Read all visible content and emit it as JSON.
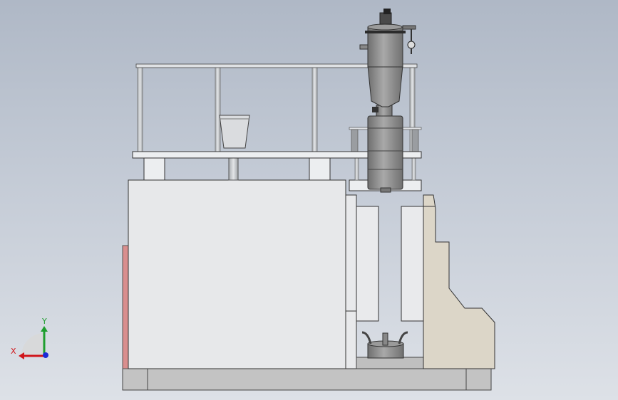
{
  "viewport": {
    "background_top": "#afb8c6",
    "background_bottom": "#dde1e7"
  },
  "triad": {
    "x_label": "X",
    "y_label": "Y",
    "x_color": "#d0161b",
    "y_color": "#1e9e2e",
    "z_color": "#1b2bd6"
  },
  "materials": {
    "frame_panel": "#e7e8ea",
    "steel_gray": "#8e8e8e",
    "base_gray": "#c3c3c3",
    "beige_side": "#dcd6c8",
    "red_panel": "#d98e8e"
  }
}
